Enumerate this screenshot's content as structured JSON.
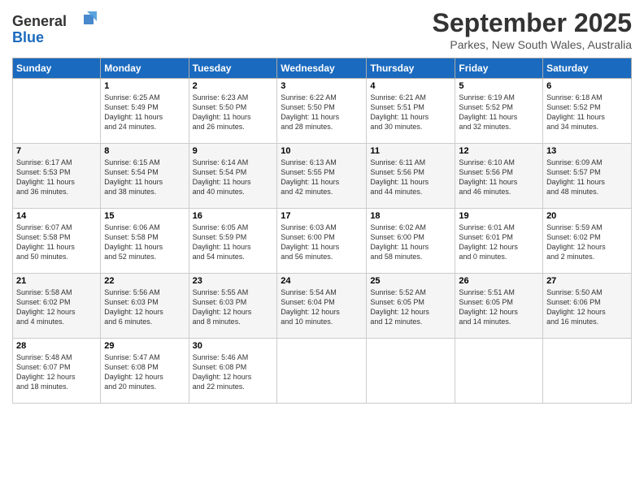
{
  "logo": {
    "line1": "General",
    "line2": "Blue"
  },
  "title": "September 2025",
  "subtitle": "Parkes, New South Wales, Australia",
  "columns": [
    "Sunday",
    "Monday",
    "Tuesday",
    "Wednesday",
    "Thursday",
    "Friday",
    "Saturday"
  ],
  "weeks": [
    [
      {
        "day": "",
        "info": ""
      },
      {
        "day": "1",
        "info": "Sunrise: 6:25 AM\nSunset: 5:49 PM\nDaylight: 11 hours\nand 24 minutes."
      },
      {
        "day": "2",
        "info": "Sunrise: 6:23 AM\nSunset: 5:50 PM\nDaylight: 11 hours\nand 26 minutes."
      },
      {
        "day": "3",
        "info": "Sunrise: 6:22 AM\nSunset: 5:50 PM\nDaylight: 11 hours\nand 28 minutes."
      },
      {
        "day": "4",
        "info": "Sunrise: 6:21 AM\nSunset: 5:51 PM\nDaylight: 11 hours\nand 30 minutes."
      },
      {
        "day": "5",
        "info": "Sunrise: 6:19 AM\nSunset: 5:52 PM\nDaylight: 11 hours\nand 32 minutes."
      },
      {
        "day": "6",
        "info": "Sunrise: 6:18 AM\nSunset: 5:52 PM\nDaylight: 11 hours\nand 34 minutes."
      }
    ],
    [
      {
        "day": "7",
        "info": "Sunrise: 6:17 AM\nSunset: 5:53 PM\nDaylight: 11 hours\nand 36 minutes."
      },
      {
        "day": "8",
        "info": "Sunrise: 6:15 AM\nSunset: 5:54 PM\nDaylight: 11 hours\nand 38 minutes."
      },
      {
        "day": "9",
        "info": "Sunrise: 6:14 AM\nSunset: 5:54 PM\nDaylight: 11 hours\nand 40 minutes."
      },
      {
        "day": "10",
        "info": "Sunrise: 6:13 AM\nSunset: 5:55 PM\nDaylight: 11 hours\nand 42 minutes."
      },
      {
        "day": "11",
        "info": "Sunrise: 6:11 AM\nSunset: 5:56 PM\nDaylight: 11 hours\nand 44 minutes."
      },
      {
        "day": "12",
        "info": "Sunrise: 6:10 AM\nSunset: 5:56 PM\nDaylight: 11 hours\nand 46 minutes."
      },
      {
        "day": "13",
        "info": "Sunrise: 6:09 AM\nSunset: 5:57 PM\nDaylight: 11 hours\nand 48 minutes."
      }
    ],
    [
      {
        "day": "14",
        "info": "Sunrise: 6:07 AM\nSunset: 5:58 PM\nDaylight: 11 hours\nand 50 minutes."
      },
      {
        "day": "15",
        "info": "Sunrise: 6:06 AM\nSunset: 5:58 PM\nDaylight: 11 hours\nand 52 minutes."
      },
      {
        "day": "16",
        "info": "Sunrise: 6:05 AM\nSunset: 5:59 PM\nDaylight: 11 hours\nand 54 minutes."
      },
      {
        "day": "17",
        "info": "Sunrise: 6:03 AM\nSunset: 6:00 PM\nDaylight: 11 hours\nand 56 minutes."
      },
      {
        "day": "18",
        "info": "Sunrise: 6:02 AM\nSunset: 6:00 PM\nDaylight: 11 hours\nand 58 minutes."
      },
      {
        "day": "19",
        "info": "Sunrise: 6:01 AM\nSunset: 6:01 PM\nDaylight: 12 hours\nand 0 minutes."
      },
      {
        "day": "20",
        "info": "Sunrise: 5:59 AM\nSunset: 6:02 PM\nDaylight: 12 hours\nand 2 minutes."
      }
    ],
    [
      {
        "day": "21",
        "info": "Sunrise: 5:58 AM\nSunset: 6:02 PM\nDaylight: 12 hours\nand 4 minutes."
      },
      {
        "day": "22",
        "info": "Sunrise: 5:56 AM\nSunset: 6:03 PM\nDaylight: 12 hours\nand 6 minutes."
      },
      {
        "day": "23",
        "info": "Sunrise: 5:55 AM\nSunset: 6:03 PM\nDaylight: 12 hours\nand 8 minutes."
      },
      {
        "day": "24",
        "info": "Sunrise: 5:54 AM\nSunset: 6:04 PM\nDaylight: 12 hours\nand 10 minutes."
      },
      {
        "day": "25",
        "info": "Sunrise: 5:52 AM\nSunset: 6:05 PM\nDaylight: 12 hours\nand 12 minutes."
      },
      {
        "day": "26",
        "info": "Sunrise: 5:51 AM\nSunset: 6:05 PM\nDaylight: 12 hours\nand 14 minutes."
      },
      {
        "day": "27",
        "info": "Sunrise: 5:50 AM\nSunset: 6:06 PM\nDaylight: 12 hours\nand 16 minutes."
      }
    ],
    [
      {
        "day": "28",
        "info": "Sunrise: 5:48 AM\nSunset: 6:07 PM\nDaylight: 12 hours\nand 18 minutes."
      },
      {
        "day": "29",
        "info": "Sunrise: 5:47 AM\nSunset: 6:08 PM\nDaylight: 12 hours\nand 20 minutes."
      },
      {
        "day": "30",
        "info": "Sunrise: 5:46 AM\nSunset: 6:08 PM\nDaylight: 12 hours\nand 22 minutes."
      },
      {
        "day": "",
        "info": ""
      },
      {
        "day": "",
        "info": ""
      },
      {
        "day": "",
        "info": ""
      },
      {
        "day": "",
        "info": ""
      }
    ]
  ]
}
